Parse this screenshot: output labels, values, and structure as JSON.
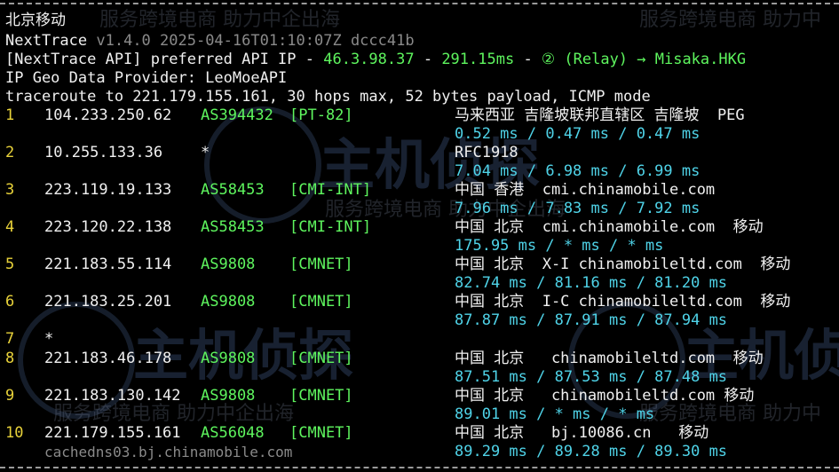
{
  "watermark": {
    "top_left": "北京移动",
    "service": "服务跨境电商 助力中企出海",
    "service_dup": "服务跨境电商 助力中",
    "service_mid": "服务跨境电商 助力中企出海",
    "logo": "主机侦探"
  },
  "header": {
    "title": "北京移动",
    "app_name": "NextTrace",
    "version": "v1.4.0 2025-04-16T01:10:07Z dccc41b",
    "api_prefix": "[NextTrace API] preferred API IP - ",
    "api_ip": "46.3.98.37",
    "api_sep": " - ",
    "api_latency": "291.15ms",
    "api_sep2": " - ",
    "api_relay": "② (Relay) → Misaka.HKG",
    "geo_provider": "IP Geo Data Provider: LeoMoeAPI",
    "traceroute_cmd": "traceroute to 221.179.155.161, 30 hops max, 52 bytes payload, ICMP mode"
  },
  "hops": [
    {
      "num": "1",
      "ip": "104.233.250.62",
      "asn": "AS394432",
      "tag": "[PT-82]",
      "geo": "马来西亚 吉隆坡联邦直辖区 吉隆坡  PEG",
      "rtt": "0.52 ms / 0.47 ms / 0.47 ms"
    },
    {
      "num": "2",
      "ip": "10.255.133.36",
      "asn": "*",
      "tag": "",
      "geo": "RFC1918",
      "rtt": "7.04 ms / 6.98 ms / 6.99 ms"
    },
    {
      "num": "3",
      "ip": "223.119.19.133",
      "asn": "AS58453",
      "tag": "[CMI-INT]",
      "geo": "中国 香港  cmi.chinamobile.com",
      "rtt": "7.96 ms / 7.83 ms / 7.92 ms"
    },
    {
      "num": "4",
      "ip": "223.120.22.138",
      "asn": "AS58453",
      "tag": "[CMI-INT]",
      "geo": "中国 北京  cmi.chinamobile.com  移动",
      "rtt": "175.95 ms / * ms / * ms"
    },
    {
      "num": "5",
      "ip": "221.183.55.114",
      "asn": "AS9808",
      "tag": "[CMNET]",
      "geo": "中国 北京  X-I chinamobileltd.com  移动",
      "rtt": "82.74 ms / 81.16 ms / 81.20 ms"
    },
    {
      "num": "6",
      "ip": "221.183.25.201",
      "asn": "AS9808",
      "tag": "[CMNET]",
      "geo": "中国 北京  I-C chinamobileltd.com  移动",
      "rtt": "87.87 ms / 87.91 ms / 87.94 ms"
    },
    {
      "num": "7",
      "ip": "*",
      "asn": "",
      "tag": "",
      "geo": "",
      "rtt": ""
    },
    {
      "num": "8",
      "ip": "221.183.46.178",
      "asn": "AS9808",
      "tag": "[CMNET]",
      "geo": "中国 北京   chinamobileltd.com  移动",
      "rtt": "87.51 ms / 87.53 ms / 87.48 ms"
    },
    {
      "num": "9",
      "ip": "221.183.130.142",
      "asn": "AS9808",
      "tag": "[CMNET]",
      "geo": "中国 北京   chinamobileltd.com 移动",
      "rtt": "89.01 ms / * ms / * ms"
    },
    {
      "num": "10",
      "ip": "221.179.155.161",
      "asn": "AS56048",
      "tag": "[CMNET]",
      "geo": "中国 北京   bj.10086.cn   移动",
      "rtt": "89.29 ms / 89.28 ms / 89.30 ms",
      "ptr": "cachedns03.bj.chinamobile.com"
    }
  ],
  "colors": {
    "background": "#000000",
    "hop_number": "#e8d23a",
    "asn": "#5ef55e",
    "rtt": "#4fd3e8",
    "api_ip": "#5ef55e"
  }
}
